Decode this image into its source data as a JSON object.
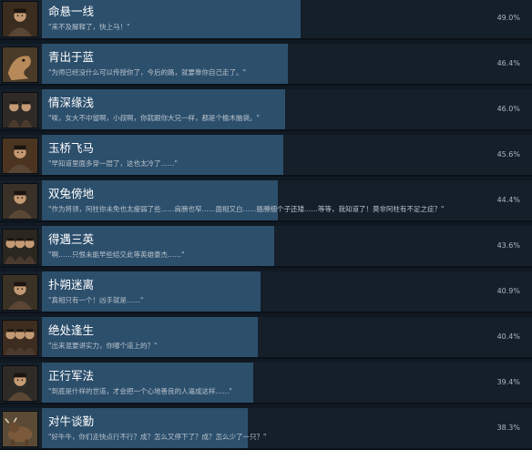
{
  "colors": {
    "bar": "#2c4f6c",
    "row_bg": "#151f2a",
    "page_bg": "#101922"
  },
  "achievements": [
    {
      "title": "命悬一线",
      "desc": "\"来不及解释了，快上马！\"",
      "percent": "49.0%",
      "value": 49.0,
      "icon": "horse-rider-portrait-icon"
    },
    {
      "title": "青出于蓝",
      "desc": "\"为师已经没什么可以传授你了，今后的路，就要靠你自己走了。\"",
      "percent": "46.4%",
      "value": 46.4,
      "icon": "dragon-portrait-icon"
    },
    {
      "title": "情深缘浅",
      "desc": "\"唉，女大不中留啊，小叔啊，你就跟你大兄一样，都是个榆木脑袋。\"",
      "percent": "46.0%",
      "value": 46.0,
      "icon": "couple-portrait-icon"
    },
    {
      "title": "玉桥飞马",
      "desc": "\"早知道里面多穿一层了，这也太冷了……\"",
      "percent": "45.6%",
      "value": 45.6,
      "icon": "warrior-portrait-icon"
    },
    {
      "title": "双兔傍地",
      "desc": "\"作为将领，阿柱你未免也太瘦弱了些……肩膀也窄……面相又白……胳膊细个子还矮……等等，我知道了！莫非阿柱有不足之症？\"",
      "percent": "44.4%",
      "value": 44.4,
      "icon": "general-portrait-icon"
    },
    {
      "title": "得遇三英",
      "desc": "\"啊……只恨未能早些结交此等英雄豪杰……\"",
      "percent": "43.6%",
      "value": 43.6,
      "icon": "three-heroes-portrait-icon"
    },
    {
      "title": "扑朔迷离",
      "desc": "\"真相只有一个！凶手就是……\"",
      "percent": "40.9%",
      "value": 40.9,
      "icon": "detective-portrait-icon"
    },
    {
      "title": "绝处逢生",
      "desc": "\"出来混要讲实力，你哪个道上的？\"",
      "percent": "40.4%",
      "value": 40.4,
      "icon": "bandits-portrait-icon"
    },
    {
      "title": "正行军法",
      "desc": "\"到底是什样的世道，才会把一个心地善良的人逼成这样……\"",
      "percent": "39.4%",
      "value": 39.4,
      "icon": "officer-portrait-icon"
    },
    {
      "title": "对牛谈勤",
      "desc": "\"好牛牛，你们走快点行不行？成？怎么又停下了？成？怎么少了一只？\"",
      "percent": "38.3%",
      "value": 38.3,
      "icon": "ox-icon"
    }
  ]
}
